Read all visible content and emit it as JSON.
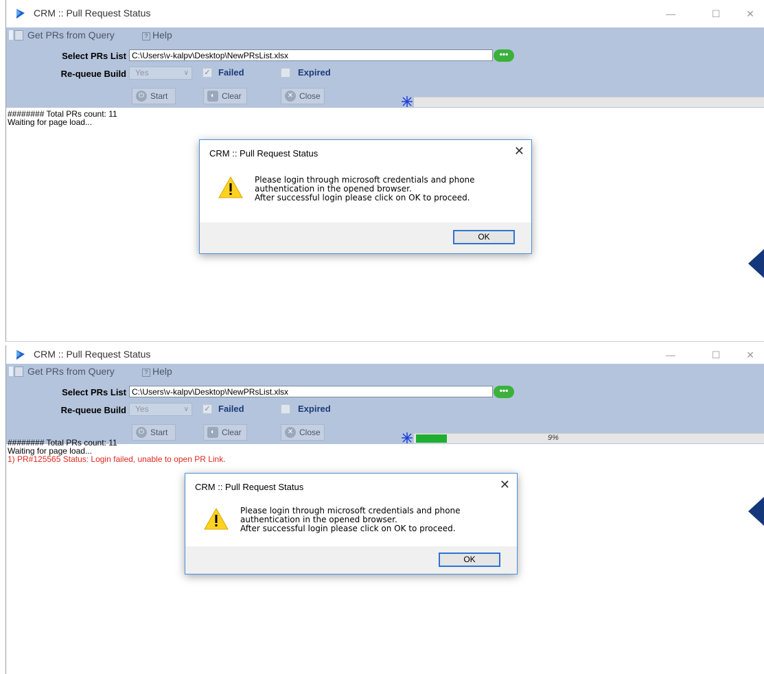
{
  "window1": {
    "title": "CRM :: Pull Request Status",
    "menu": {
      "get_prs": "Get PRs from Query",
      "help": "Help"
    },
    "form": {
      "select_label": "Select PRs List",
      "path_value": "C:\\Users\\v-kalpv\\Desktop\\NewPRsList.xlsx",
      "browse_label": "•••",
      "requeue_label": "Re-queue Build",
      "requeue_value": "Yes",
      "failed_label": "Failed",
      "expired_label": "Expired"
    },
    "buttons": {
      "start": "Start",
      "clear": "Clear",
      "close": "Close"
    },
    "log": [
      "######## Total PRs count: 11",
      "Waiting for page load..."
    ],
    "dialog": {
      "title": "CRM :: Pull Request Status",
      "line1": "Please login through microsoft credentials and phone",
      "line2": "authentication in the opened browser.",
      "line3": "After successful login please click on OK to proceed.",
      "ok": "OK"
    }
  },
  "window2": {
    "title": "CRM :: Pull Request Status",
    "menu": {
      "get_prs": "Get PRs from Query",
      "help": "Help"
    },
    "form": {
      "select_label": "Select PRs List",
      "path_value": "C:\\Users\\v-kalpv\\Desktop\\NewPRsList.xlsx",
      "browse_label": "•••",
      "requeue_label": "Re-queue Build",
      "requeue_value": "Yes",
      "failed_label": "Failed",
      "expired_label": "Expired"
    },
    "buttons": {
      "start": "Start",
      "clear": "Clear",
      "close": "Close"
    },
    "progress_value": 0.09,
    "progress_text": "9%",
    "log": [
      "######## Total PRs count: 11",
      "Waiting for page load..."
    ],
    "log_error": "1) PR#125565  Status: Login failed, unable to open PR Link.",
    "dialog": {
      "title": "CRM :: Pull Request Status",
      "line1": "Please login through microsoft credentials and phone",
      "line2": "authentication in the opened browser.",
      "line3": "After successful login please click on OK to proceed.",
      "ok": "OK"
    }
  },
  "colors": {
    "accent": "#b4c4dc",
    "progress": "#1fae32",
    "error": "#e0281e",
    "dialog_border": "#4a8fdc"
  },
  "icons": {
    "app": "dynamics-logo-icon",
    "warning": "warning-icon",
    "spinner": "spinner-icon"
  }
}
